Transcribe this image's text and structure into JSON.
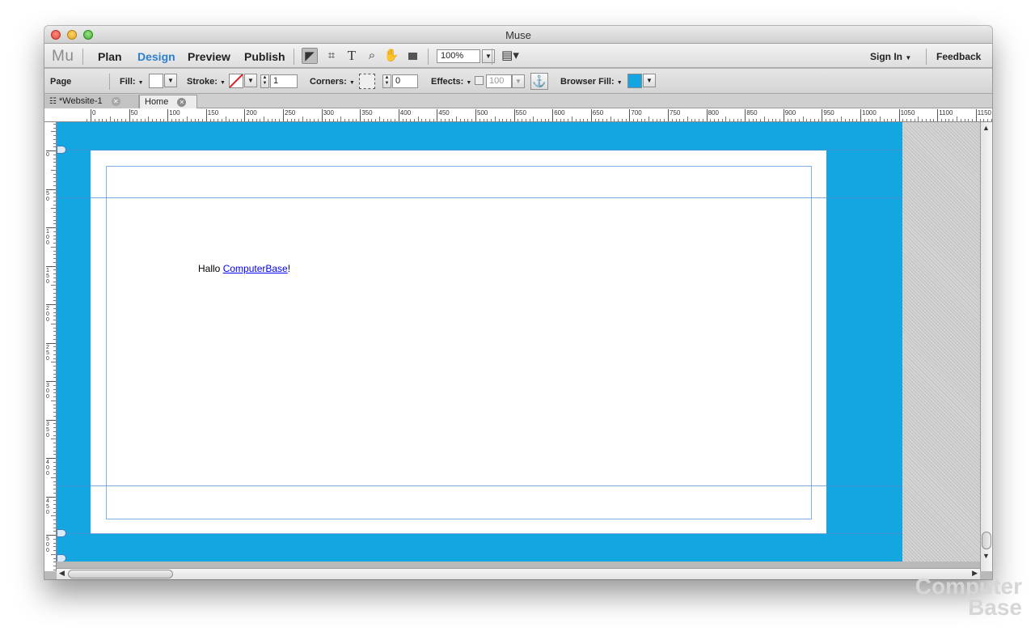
{
  "window": {
    "title": "Muse"
  },
  "appbar": {
    "logo": "Mu",
    "nav": [
      "Plan",
      "Design",
      "Preview",
      "Publish"
    ],
    "active_nav": "Design",
    "zoom_value": "100%",
    "sign_in_label": "Sign In",
    "feedback_label": "Feedback"
  },
  "control_bar": {
    "context_label": "Page",
    "fill_label": "Fill:",
    "stroke_label": "Stroke:",
    "stroke_value": "1",
    "corners_label": "Corners:",
    "corners_value": "0",
    "effects_label": "Effects:",
    "effects_value": "100",
    "browser_fill_label": "Browser Fill:",
    "browser_fill_color": "#14a6e0"
  },
  "tabs": [
    {
      "label": "*Website-1",
      "active": false
    },
    {
      "label": "Home",
      "active": true
    }
  ],
  "ruler": {
    "h_labels": [
      "0",
      "50",
      "100",
      "150",
      "200",
      "250",
      "300",
      "350",
      "400",
      "450",
      "500",
      "550",
      "600",
      "650",
      "700",
      "750",
      "800",
      "850",
      "900",
      "950",
      "1000",
      "1050",
      "1100",
      "1150"
    ],
    "v_labels": [
      "0",
      "50",
      "100",
      "150",
      "200",
      "250",
      "300",
      "350",
      "400",
      "450",
      "500"
    ]
  },
  "page": {
    "text_prefix": "Hallo ",
    "link_text": "ComputerBase",
    "text_suffix": "!"
  },
  "watermark": {
    "line1": "Computer",
    "line2": "Base"
  },
  "colors": {
    "browser_fill": "#14a6e0",
    "accent_nav": "#2d7fd1"
  }
}
